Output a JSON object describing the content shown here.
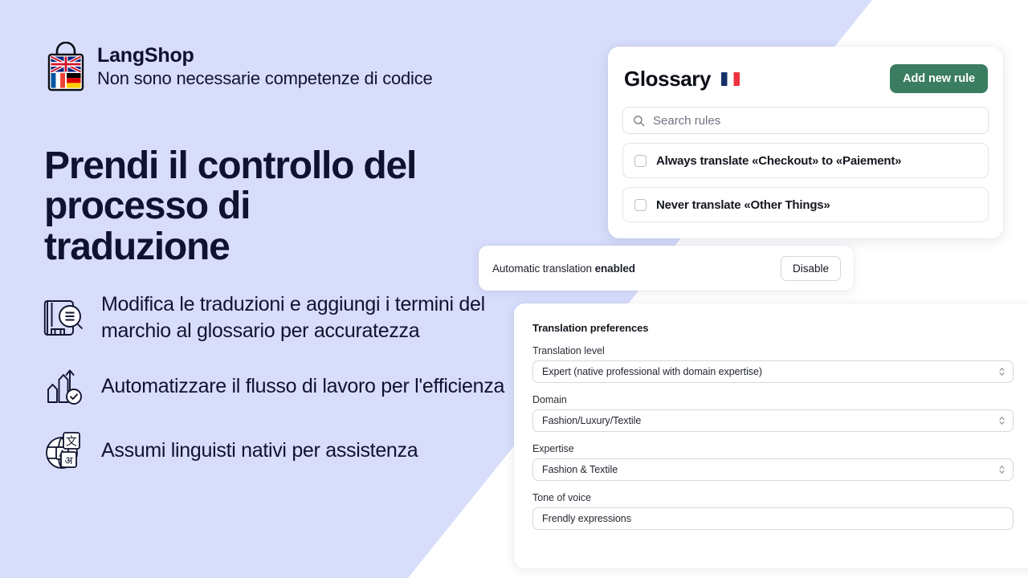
{
  "theme": {
    "background": "#d7ddfb",
    "panel": "#ffffff",
    "text_dark": "#10132f",
    "accent_green": "#3b7d61"
  },
  "brand": {
    "name": "LangShop",
    "tagline": "Non sono necessarie competenze di codice",
    "logo_icon": "shopping-bag-flags-icon"
  },
  "hero": {
    "headline": "Prendi il controllo del processo di traduzione"
  },
  "features": [
    {
      "icon": "book-magnifier-icon",
      "text": "Modifica le traduzioni e aggiungi i termini del marchio al glossario per accuratezza"
    },
    {
      "icon": "growth-arrows-check-icon",
      "text": "Automatizzare il flusso di lavoro per l'efficienza"
    },
    {
      "icon": "translate-globe-icon",
      "text": "Assumi linguisti nativi per assistenza"
    }
  ],
  "glossary": {
    "title": "Glossary",
    "flag_icon": "france-flag-icon",
    "add_rule_label": "Add new rule",
    "search": {
      "icon": "search-icon",
      "value": "",
      "placeholder": "Search rules"
    },
    "rules": [
      {
        "label": "Always translate «Checkout» to «Paiement»",
        "checked": false
      },
      {
        "label": "Never translate «Other Things»",
        "checked": false
      }
    ]
  },
  "auto_translation": {
    "text_prefix": "Automatic translation ",
    "status": "enabled",
    "button_label": "Disable"
  },
  "preferences": {
    "title": "Translation preferences",
    "fields": [
      {
        "label": "Translation level",
        "value": "Expert (native professional with domain expertise)",
        "control": "select"
      },
      {
        "label": "Domain",
        "value": "Fashion/Luxury/Textile",
        "control": "select"
      },
      {
        "label": "Expertise",
        "value": "Fashion & Textile",
        "control": "select"
      },
      {
        "label": "Tone of voice",
        "value": "Frendly expressions",
        "control": "text"
      }
    ]
  }
}
